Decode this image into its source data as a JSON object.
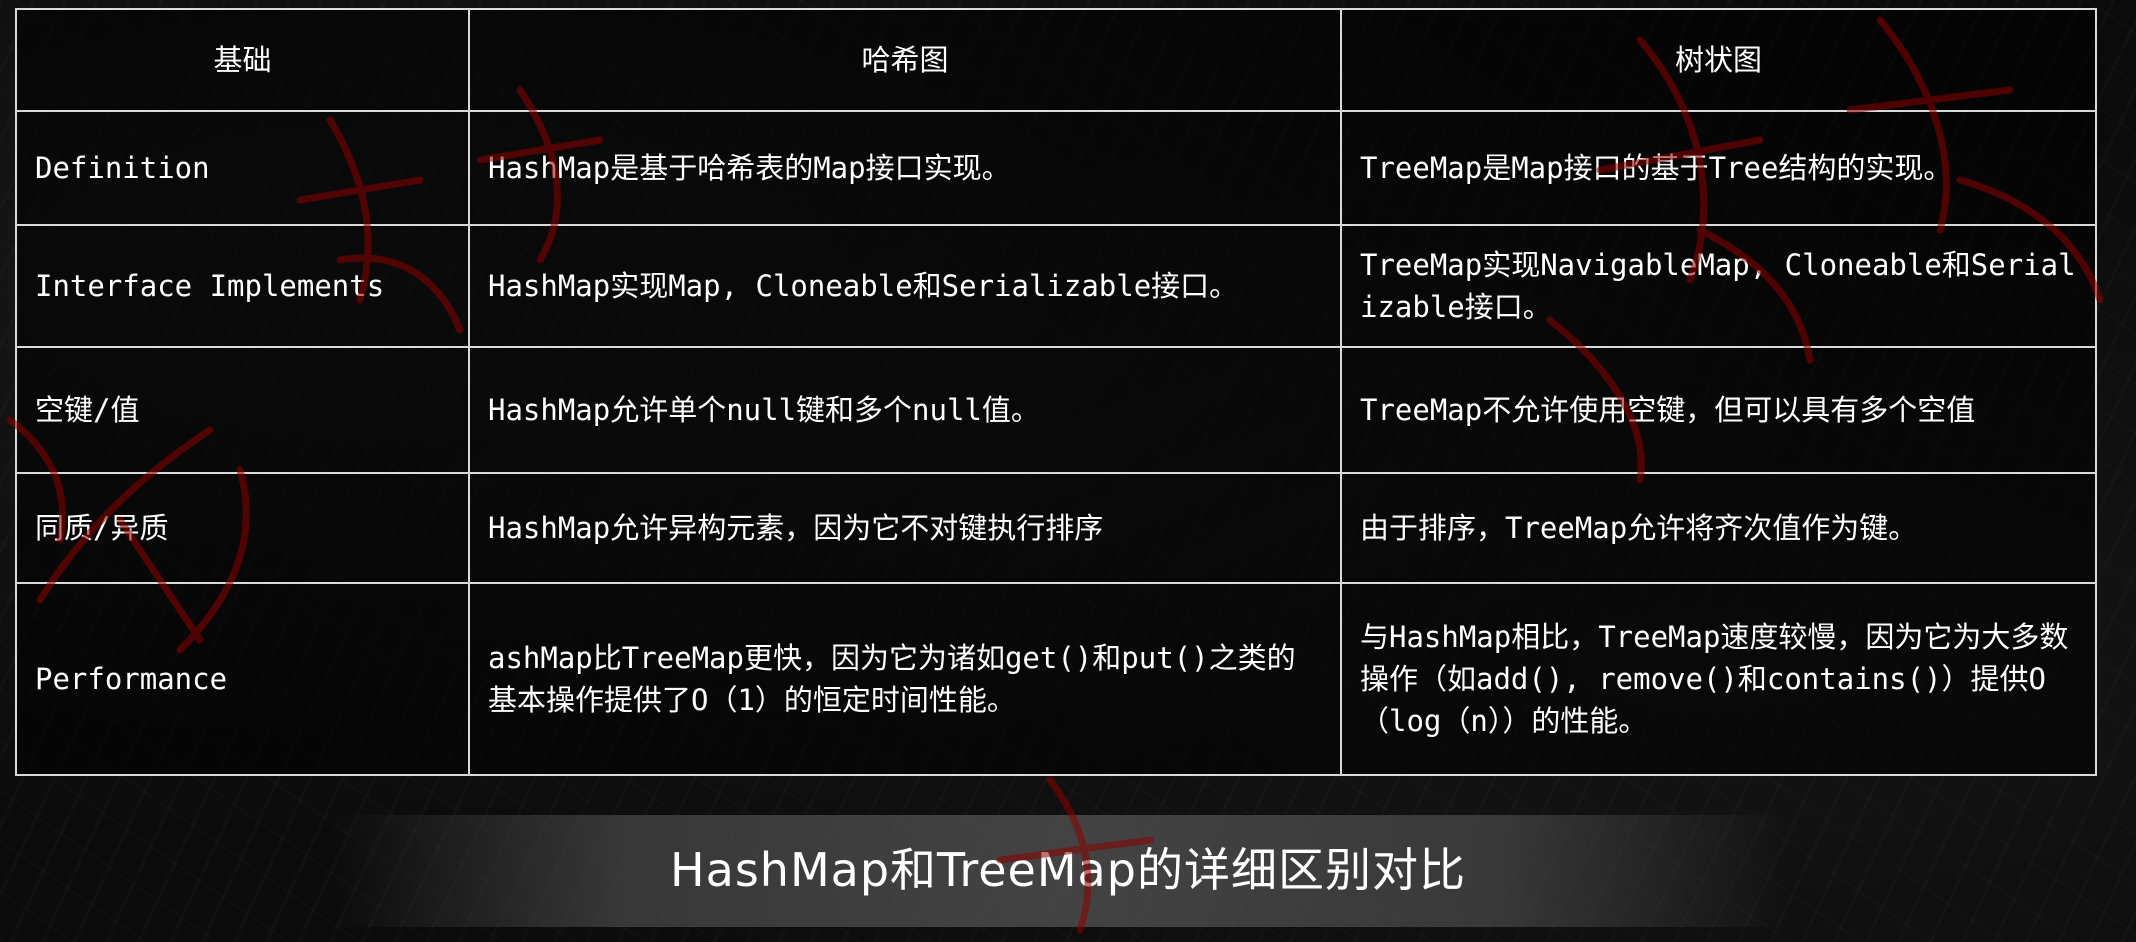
{
  "table": {
    "headers": [
      "基础",
      "哈希图",
      "树状图"
    ],
    "rows": [
      {
        "basis": "Definition",
        "hashmap": "HashMap是基于哈希表的Map接口实现。",
        "treemap": "TreeMap是Map接口的基于Tree结构的实现。"
      },
      {
        "basis": "Interface Implements",
        "hashmap": "HashMap实现Map, Cloneable和Serializable接口。",
        "treemap": "TreeMap实现NavigableMap, Cloneable和Serializable接口。"
      },
      {
        "basis": "空键/值",
        "hashmap": "HashMap允许单个null键和多个null值。",
        "treemap": "TreeMap不允许使用空键，但可以具有多个空值"
      },
      {
        "basis": "同质/异质",
        "hashmap": "HashMap允许异构元素，因为它不对键执行排序",
        "treemap": "由于排序，TreeMap允许将齐次值作为键。"
      },
      {
        "basis": "Performance",
        "hashmap": "ashMap比TreeMap更快，因为它为诸如get()和put()之类的基本操作提供了O（1）的恒定时间性能。",
        "treemap": "与HashMap相比，TreeMap速度较慢，因为它为大多数操作（如add(), remove()和contains()）提供O（log（n））的性能。"
      }
    ]
  },
  "caption": "HashMap和TreeMap的详细区别对比",
  "colors": {
    "background": "#0b0b0b",
    "text": "#ffffff",
    "border": "#d9d9d9",
    "watermark": "#8b0000"
  }
}
